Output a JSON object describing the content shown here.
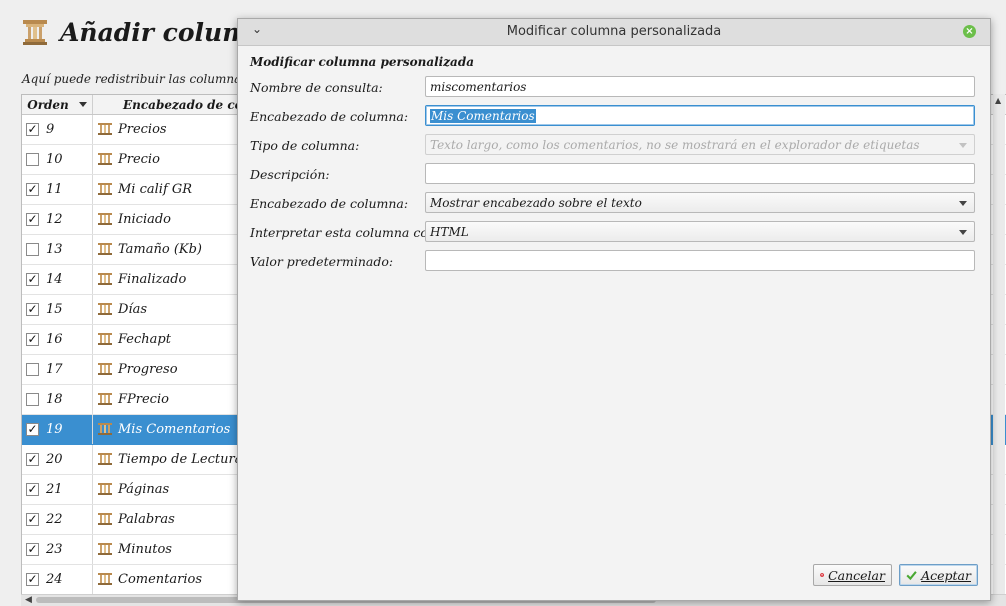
{
  "page": {
    "title": "Añadir columna",
    "description": "Aquí puede redistribuir las columnas en l"
  },
  "table": {
    "headers": {
      "order": "Orden",
      "heading": "Encabezado de colum"
    },
    "rows": [
      {
        "checked": true,
        "order": "9",
        "name": "Precios"
      },
      {
        "checked": false,
        "order": "10",
        "name": "Precio"
      },
      {
        "checked": true,
        "order": "11",
        "name": "Mi calif GR"
      },
      {
        "checked": true,
        "order": "12",
        "name": "Iniciado"
      },
      {
        "checked": false,
        "order": "13",
        "name": "Tamaño (Kb)"
      },
      {
        "checked": true,
        "order": "14",
        "name": "Finalizado"
      },
      {
        "checked": true,
        "order": "15",
        "name": "Días"
      },
      {
        "checked": true,
        "order": "16",
        "name": "Fechapt"
      },
      {
        "checked": false,
        "order": "17",
        "name": "Progreso"
      },
      {
        "checked": false,
        "order": "18",
        "name": "FPrecio"
      },
      {
        "checked": true,
        "order": "19",
        "name": "Mis Comentarios",
        "selected": true
      },
      {
        "checked": true,
        "order": "20",
        "name": "Tiempo de Lectura"
      },
      {
        "checked": true,
        "order": "21",
        "name": "Páginas"
      },
      {
        "checked": true,
        "order": "22",
        "name": "Palabras"
      },
      {
        "checked": true,
        "order": "23",
        "name": "Minutos"
      },
      {
        "checked": true,
        "order": "24",
        "name": "Comentarios"
      }
    ]
  },
  "dialog": {
    "window_title": "Modificar columna personalizada",
    "header": "Modificar columna personalizada",
    "fields": {
      "lookup_name": {
        "label": "Nombre de consulta:",
        "value": "miscomentarios"
      },
      "column_heading": {
        "label": "Encabezado de columna:",
        "value": "Mis Comentarios"
      },
      "column_type": {
        "label": "Tipo de columna:",
        "value": "Texto largo, como los comentarios, no se mostrará en el explorador de etiquetas"
      },
      "description": {
        "label": "Descripción:",
        "value": ""
      },
      "heading_position": {
        "label": "Encabezado de columna:",
        "value": "Mostrar encabezado sobre el texto"
      },
      "interpret_as": {
        "label": "Interpretar esta columna como:",
        "value": "HTML"
      },
      "default_value": {
        "label": "Valor predeterminado:",
        "value": ""
      }
    },
    "buttons": {
      "cancel": "Cancelar",
      "ok": "Aceptar"
    }
  },
  "colors": {
    "selection": "#3a8fd0",
    "cancel_icon": "#d9262f",
    "ok_icon": "#49a832",
    "close_button": "#6cbf4a"
  },
  "icons": {
    "column_icon": "column-pillar-icon"
  }
}
